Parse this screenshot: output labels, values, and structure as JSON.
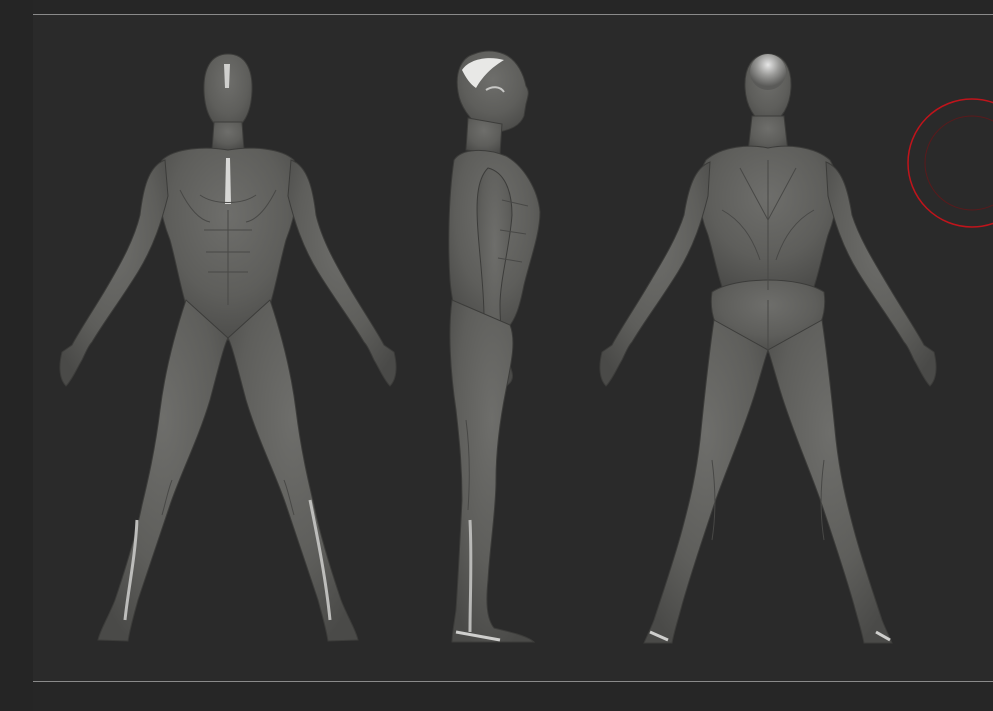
{
  "viewport": {
    "views": [
      "front",
      "side",
      "back"
    ],
    "model": "ecorche-male-figure",
    "surface_color": "#626260",
    "background_color": "#2a2a2a",
    "frame_line_color": "#8a8a8a",
    "brush_color": "#c0141b"
  }
}
